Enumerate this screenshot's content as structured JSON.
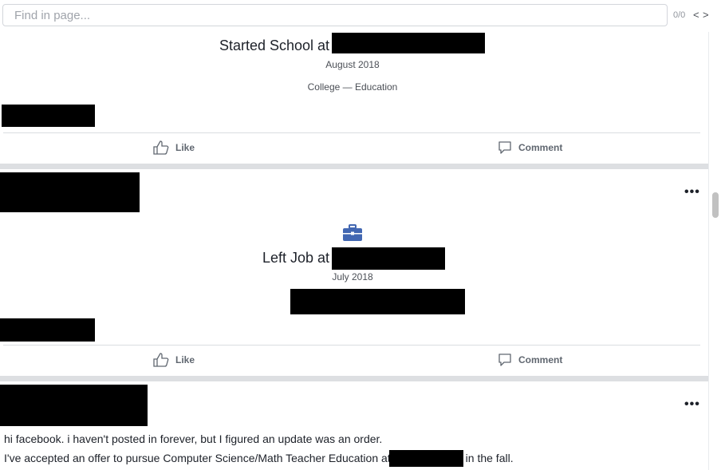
{
  "find_bar": {
    "placeholder": "Find in page...",
    "count": "0/0",
    "prev": "<",
    "next": ">"
  },
  "posts": [
    {
      "milestone_title": "Started School at",
      "date": "August 2018",
      "detail": "College — Education",
      "like_label": "Like",
      "comment_label": "Comment"
    },
    {
      "milestone_title": "Left Job at",
      "date": "July 2018",
      "icon": "briefcase-icon",
      "like_label": "Like",
      "comment_label": "Comment",
      "more": "•••"
    },
    {
      "more": "•••",
      "line1": "hi facebook. i haven't posted in forever, but I figured an update was an order.",
      "line2_before": "I've accepted an offer to pursue Computer Science/Math Teacher Education at",
      "line2_after": "in the fall."
    }
  ],
  "colors": {
    "redaction": "#000000",
    "icon_blue": "#4267b2",
    "divider": "#dddfe2"
  }
}
